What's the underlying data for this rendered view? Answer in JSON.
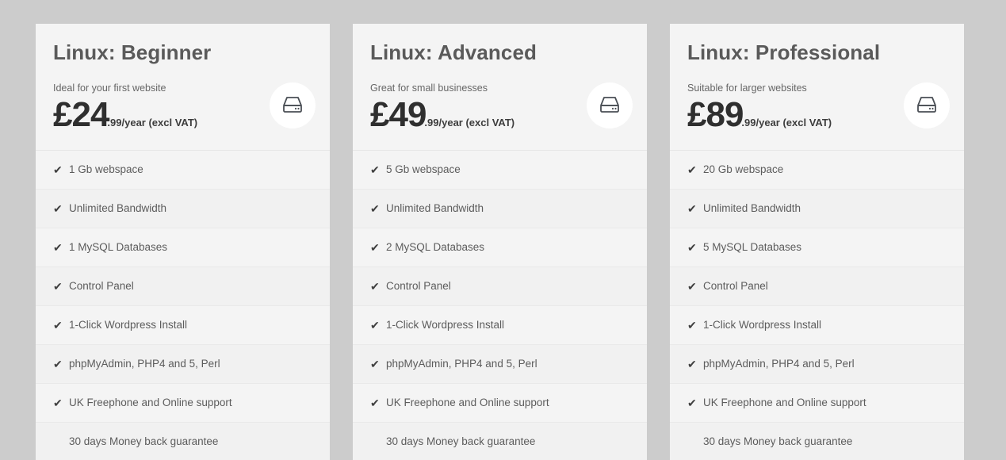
{
  "page": {
    "background_color": "#cccccc",
    "card_background_color": "#f4f4f4",
    "icon_name": "hard-drive-icon"
  },
  "plans": [
    {
      "title": "Linux: Beginner",
      "subtitle": "Ideal for your first website",
      "price_main": "£24",
      "price_suffix": ".99/year (excl VAT)",
      "features": [
        {
          "label": "1 Gb webspace",
          "check": "✔"
        },
        {
          "label": "Unlimited Bandwidth",
          "check": "✔"
        },
        {
          "label": "1 MySQL Databases",
          "check": "✔"
        },
        {
          "label": "Control Panel",
          "check": "✔"
        },
        {
          "label": "1-Click Wordpress Install",
          "check": "✔"
        },
        {
          "label": "phpMyAdmin, PHP4 and 5, Perl",
          "check": "✔"
        },
        {
          "label": "UK Freephone and Online support",
          "check": "✔"
        },
        {
          "label": "30 days Money back guarantee",
          "check": ""
        }
      ]
    },
    {
      "title": "Linux: Advanced",
      "subtitle": "Great for small businesses",
      "price_main": "£49",
      "price_suffix": ".99/year (excl VAT)",
      "features": [
        {
          "label": "5 Gb webspace",
          "check": "✔"
        },
        {
          "label": "Unlimited Bandwidth",
          "check": "✔"
        },
        {
          "label": "2 MySQL Databases",
          "check": "✔"
        },
        {
          "label": "Control Panel",
          "check": "✔"
        },
        {
          "label": "1-Click Wordpress Install",
          "check": "✔"
        },
        {
          "label": "phpMyAdmin, PHP4 and 5, Perl",
          "check": "✔"
        },
        {
          "label": "UK Freephone and Online support",
          "check": "✔"
        },
        {
          "label": "30 days Money back guarantee",
          "check": ""
        }
      ]
    },
    {
      "title": "Linux: Professional",
      "subtitle": "Suitable for larger websites",
      "price_main": "£89",
      "price_suffix": ".99/year (excl VAT)",
      "features": [
        {
          "label": "20 Gb webspace",
          "check": "✔"
        },
        {
          "label": "Unlimited Bandwidth",
          "check": "✔"
        },
        {
          "label": "5 MySQL Databases",
          "check": "✔"
        },
        {
          "label": "Control Panel",
          "check": "✔"
        },
        {
          "label": "1-Click Wordpress Install",
          "check": "✔"
        },
        {
          "label": "phpMyAdmin, PHP4 and 5, Perl",
          "check": "✔"
        },
        {
          "label": "UK Freephone and Online support",
          "check": "✔"
        },
        {
          "label": "30 days Money back guarantee",
          "check": ""
        }
      ]
    }
  ]
}
